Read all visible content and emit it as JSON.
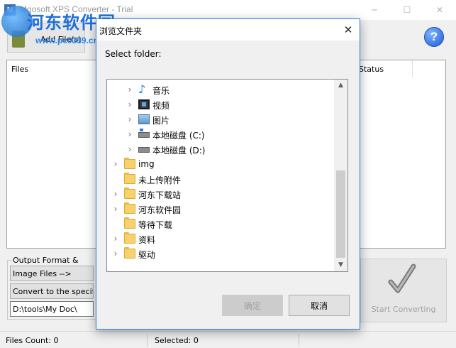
{
  "window": {
    "title": "Mgosoft XPS Converter - Trial",
    "controls": {
      "minimize": "─",
      "maximize": "☐",
      "close": "✕"
    }
  },
  "watermark": {
    "text": "河东软件园",
    "url": "www.pc0359.cn"
  },
  "toolbar": {
    "add_files_label": "Add File(s)",
    "help_label": "?"
  },
  "file_list": {
    "columns": [
      "Files",
      "Status"
    ]
  },
  "output": {
    "group_label": "Output Format & Folder",
    "format_value": "Image Files -->",
    "folder_option": "Convert to the specified folder",
    "path_value": "D:\\tools\\My Doc\\"
  },
  "start_button": {
    "label": "Start Converting"
  },
  "statusbar": {
    "files_count": "Files Count: 0",
    "selected": "Selected: 0"
  },
  "dialog": {
    "title": "浏览文件夹",
    "prompt": "Select folder:",
    "close": "✕",
    "tree": [
      {
        "label": "音乐",
        "icon": "music-icon",
        "expandable": true,
        "level": 1
      },
      {
        "label": "视频",
        "icon": "video-icon",
        "expandable": true,
        "level": 1
      },
      {
        "label": "图片",
        "icon": "picture-icon",
        "expandable": true,
        "level": 1
      },
      {
        "label": "本地磁盘 (C:)",
        "icon": "drive-c-icon",
        "expandable": true,
        "level": 1
      },
      {
        "label": "本地磁盘 (D:)",
        "icon": "drive-d-icon",
        "expandable": true,
        "level": 1
      },
      {
        "label": "img",
        "icon": "folder-icon",
        "expandable": true,
        "level": 0
      },
      {
        "label": "未上传附件",
        "icon": "folder-icon",
        "expandable": false,
        "level": 0
      },
      {
        "label": "河东下载站",
        "icon": "folder-icon",
        "expandable": true,
        "level": 0
      },
      {
        "label": "河东软件园",
        "icon": "folder-icon",
        "expandable": true,
        "level": 0
      },
      {
        "label": "等待下载",
        "icon": "folder-icon",
        "expandable": false,
        "level": 0
      },
      {
        "label": "资料",
        "icon": "folder-icon",
        "expandable": true,
        "level": 0
      },
      {
        "label": "驱动",
        "icon": "folder-icon",
        "expandable": true,
        "level": 0
      }
    ],
    "ok_label": "确定",
    "cancel_label": "取消"
  }
}
